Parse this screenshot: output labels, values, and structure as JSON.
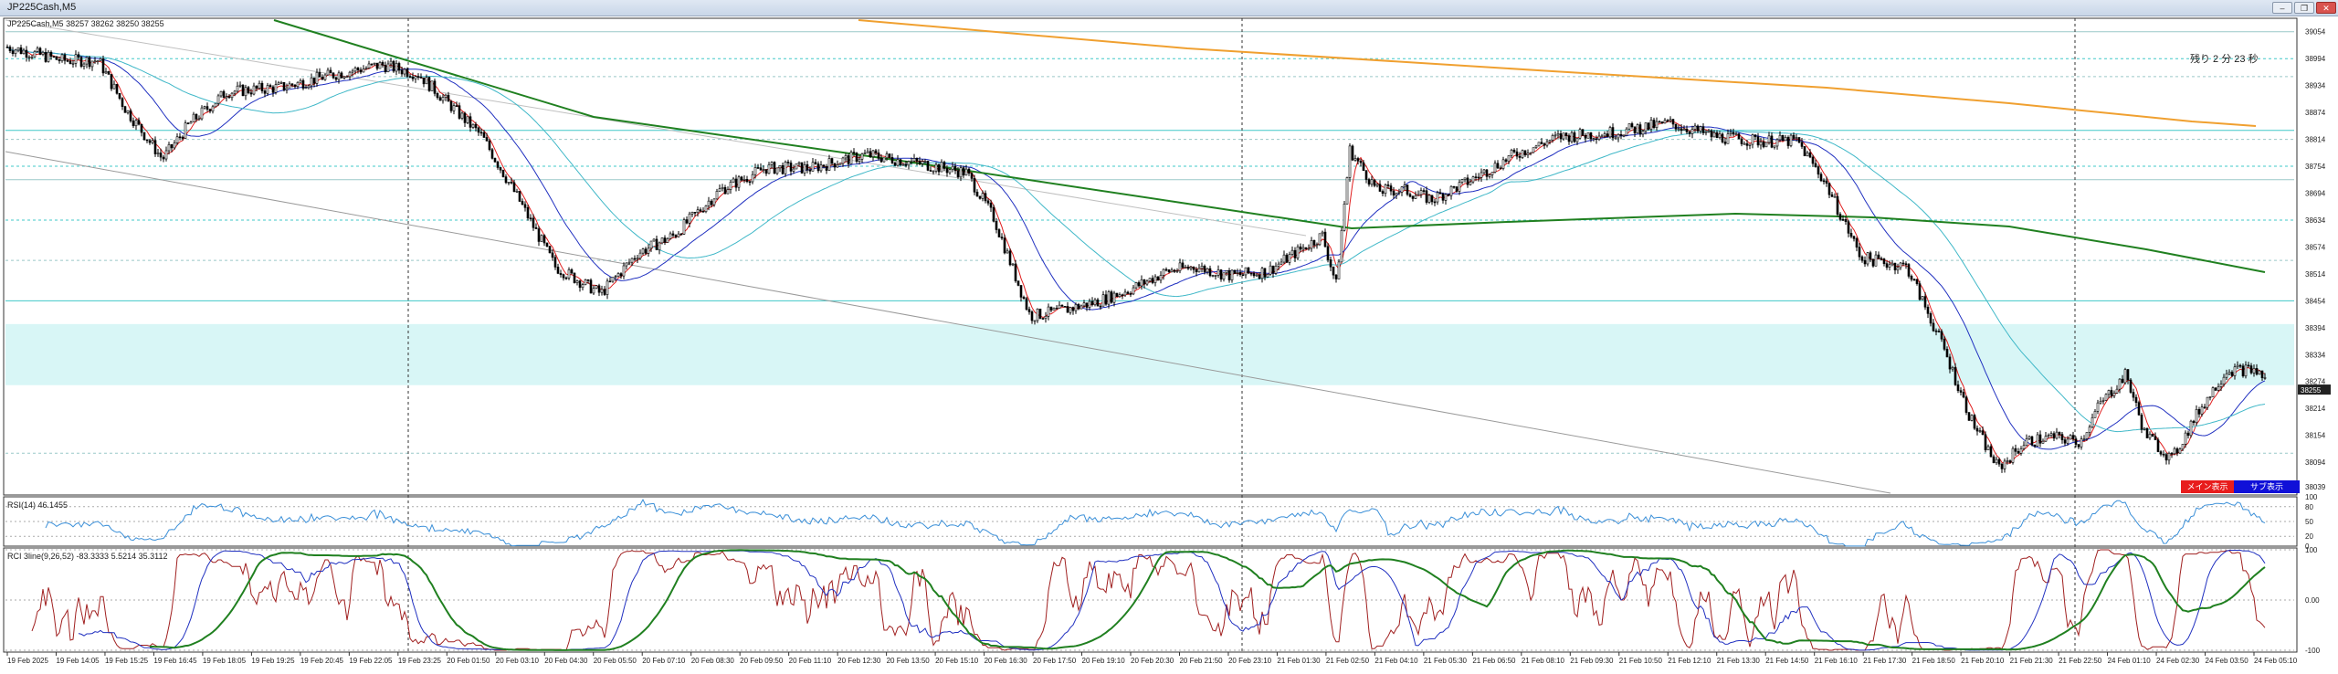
{
  "window": {
    "title": "JP225Cash,M5",
    "buttons": {
      "minimize": "–",
      "restore": "❐",
      "close": "✕"
    }
  },
  "chart": {
    "symbol_label": "JP225Cash,M5",
    "ohlc": "38257 38262 38250 38255",
    "countdown": "残り 2 分 23 秒",
    "current_price_tag": "38255",
    "buttons": {
      "main": "メイン表示",
      "sub": "サブ表示"
    },
    "price_ticks": [
      "39054",
      "38994",
      "38934",
      "38874",
      "38814",
      "38754",
      "38694",
      "38634",
      "38574",
      "38514",
      "38454",
      "38394",
      "38334",
      "38274",
      "38214",
      "38154",
      "38094",
      "38039"
    ],
    "time_ticks": [
      "19 Feb 2025",
      "19 Feb 14:05",
      "19 Feb 15:25",
      "19 Feb 16:45",
      "19 Feb 18:05",
      "19 Feb 19:25",
      "19 Feb 20:45",
      "19 Feb 22:05",
      "19 Feb 23:25",
      "20 Feb 01:50",
      "20 Feb 03:10",
      "20 Feb 04:30",
      "20 Feb 05:50",
      "20 Feb 07:10",
      "20 Feb 08:30",
      "20 Feb 09:50",
      "20 Feb 11:10",
      "20 Feb 12:30",
      "20 Feb 13:50",
      "20 Feb 15:10",
      "20 Feb 16:30",
      "20 Feb 17:50",
      "20 Feb 19:10",
      "20 Feb 20:30",
      "20 Feb 21:50",
      "20 Feb 23:10",
      "21 Feb 01:30",
      "21 Feb 02:50",
      "21 Feb 04:10",
      "21 Feb 05:30",
      "21 Feb 06:50",
      "21 Feb 08:10",
      "21 Feb 09:30",
      "21 Feb 10:50",
      "21 Feb 12:10",
      "21 Feb 13:30",
      "21 Feb 14:50",
      "21 Feb 16:10",
      "21 Feb 17:30",
      "21 Feb 18:50",
      "21 Feb 20:10",
      "21 Feb 21:30",
      "21 Feb 22:50",
      "24 Feb 01:10",
      "24 Feb 02:30",
      "24 Feb 03:50",
      "24 Feb 05:10"
    ]
  },
  "rsi": {
    "label": "RSI(14) 46.1455",
    "ticks": [
      "100",
      "80",
      "50",
      "20",
      "0"
    ]
  },
  "rci": {
    "label": "RCI 3line(9,26,52) -83.3333 5.5214 35.3112",
    "ticks": [
      "100",
      "0.00",
      "-100"
    ]
  },
  "colors": {
    "candle_bull": "#ffffff",
    "candle_bear": "#000000",
    "ma_fast": "#e02020",
    "ma_mid": "#2030c0",
    "ma_slow": "#40b8c8",
    "ma_long": "#208020",
    "ma_xlong": "#f0a030",
    "zone": "#d8f6f6",
    "level_line": "#40c8c8",
    "trendline": "#9a9a9a",
    "rsi_line": "#3a8fd8",
    "rci_short": "#a02020",
    "rci_mid": "#2030c0",
    "rci_long": "#208020"
  }
}
